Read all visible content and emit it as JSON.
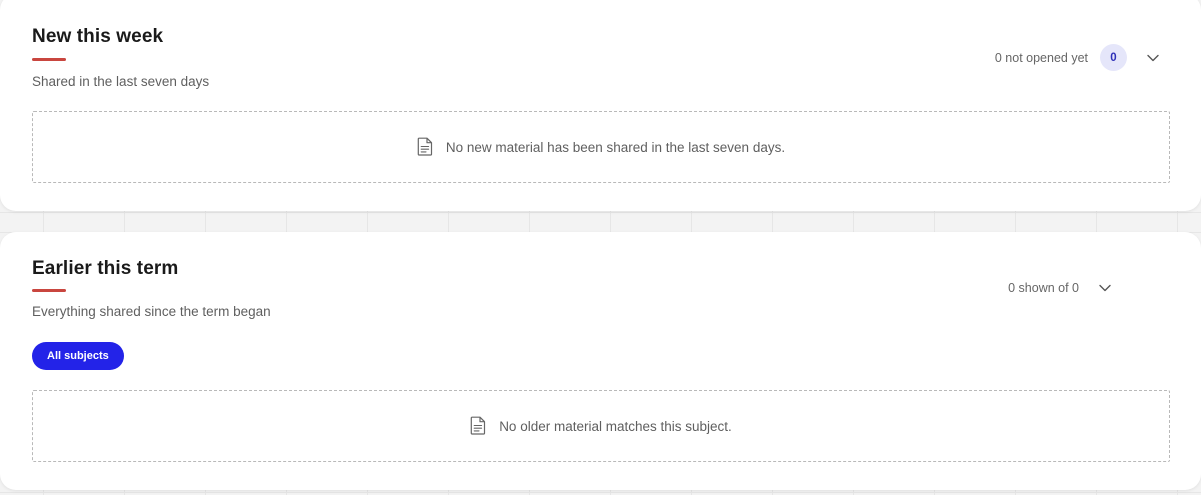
{
  "colors": {
    "accent_bar": "#c9463f",
    "badge_bg": "#e5e6fa",
    "badge_text": "#2d2fb8",
    "pill_bg": "#2323e8"
  },
  "new_section": {
    "title": "New this week",
    "subtitle": "Shared in the last seven days",
    "meta_text": "0 not opened yet",
    "badge_count": "0",
    "toggle_icon": "chevron-down-icon",
    "empty_icon": "document-icon",
    "empty_message": "No new material has been shared in the last seven days."
  },
  "earlier_section": {
    "title": "Earlier this term",
    "subtitle": "Everything shared since the term began",
    "meta_text": "0 shown of 0",
    "toggle_icon": "chevron-down-icon",
    "filter_pill": "All subjects",
    "empty_icon": "document-icon",
    "empty_message": "No older material matches this subject."
  }
}
